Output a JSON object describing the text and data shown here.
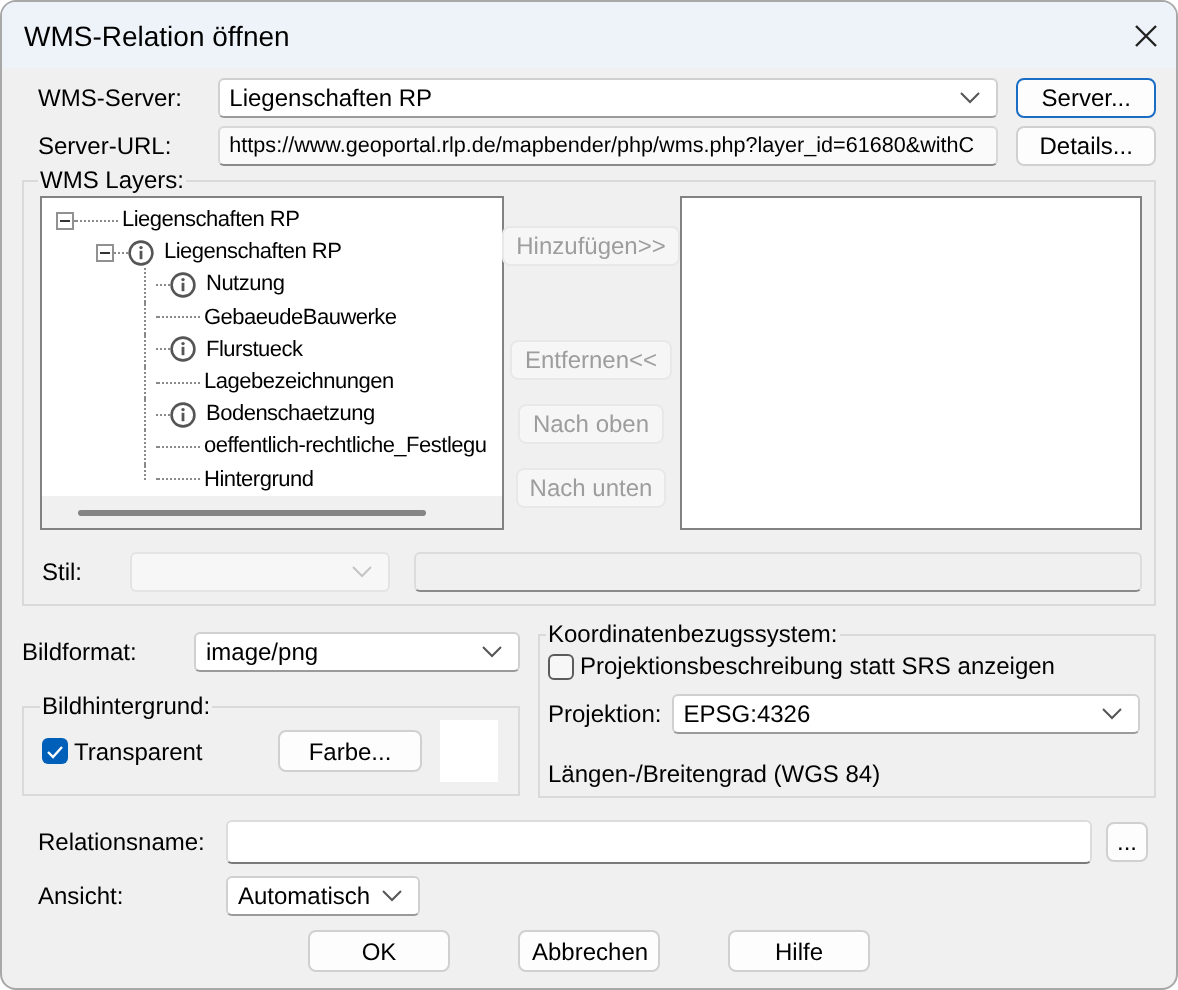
{
  "window": {
    "title": "WMS-Relation öffnen"
  },
  "wms_server": {
    "label": "WMS-Server:",
    "value": "Liegenschaften RP",
    "button": {
      "label": "Server...",
      "focused": true
    }
  },
  "server_url": {
    "label": "Server-URL:",
    "value": "https://www.geoportal.rlp.de/mapbender/php/wms.php?layer_id=61680&withC",
    "button": {
      "label": "Details...",
      "focused": false
    }
  },
  "wms_layers": {
    "title": "WMS Layers:",
    "tree": [
      {
        "label": "Liegenschaften RP",
        "info_icon": false,
        "expanded": true,
        "children": [
          {
            "label": "Liegenschaften RP",
            "info_icon": true,
            "expanded": true,
            "children": [
              {
                "label": "Nutzung",
                "info_icon": true
              },
              {
                "label": "GebaeudeBauwerke",
                "info_icon": false
              },
              {
                "label": "Flurstueck",
                "info_icon": true
              },
              {
                "label": "Lagebezeichnungen",
                "info_icon": false
              },
              {
                "label": "Bodenschaetzung",
                "info_icon": true
              },
              {
                "label": "oeffentlich-rechtliche_Festlegu",
                "info_icon": false
              },
              {
                "label": "Hintergrund",
                "info_icon": false
              }
            ]
          }
        ]
      }
    ],
    "buttons": [
      {
        "label": "Hinzufügen>>",
        "disabled": true
      },
      {
        "label": "Entfernen<<",
        "disabled": true
      },
      {
        "label": "Nach oben",
        "disabled": true
      },
      {
        "label": "Nach unten",
        "disabled": true
      }
    ],
    "style": {
      "label": "Stil:",
      "disabled": true
    }
  },
  "image_format": {
    "label": "Bildformat:",
    "value": "image/png"
  },
  "image_background": {
    "title": "Bildhintergrund:",
    "transparent": {
      "label": "Transparent",
      "checked": true
    },
    "color_button": "Farbe..."
  },
  "crs": {
    "title": "Koordinatenbezugssystem:",
    "show_description": {
      "label": "Projektionsbeschreibung statt SRS anzeigen",
      "checked": false
    },
    "projection": {
      "label": "Projektion:",
      "value": "EPSG:4326"
    },
    "description": "Längen-/Breitengrad (WGS 84)"
  },
  "relation_name": {
    "label": "Relationsname:",
    "browse_button": "..."
  },
  "view": {
    "label": "Ansicht:",
    "value": "Automatisch"
  },
  "buttons": [
    "OK",
    "Abbrechen",
    "Hilfe"
  ]
}
